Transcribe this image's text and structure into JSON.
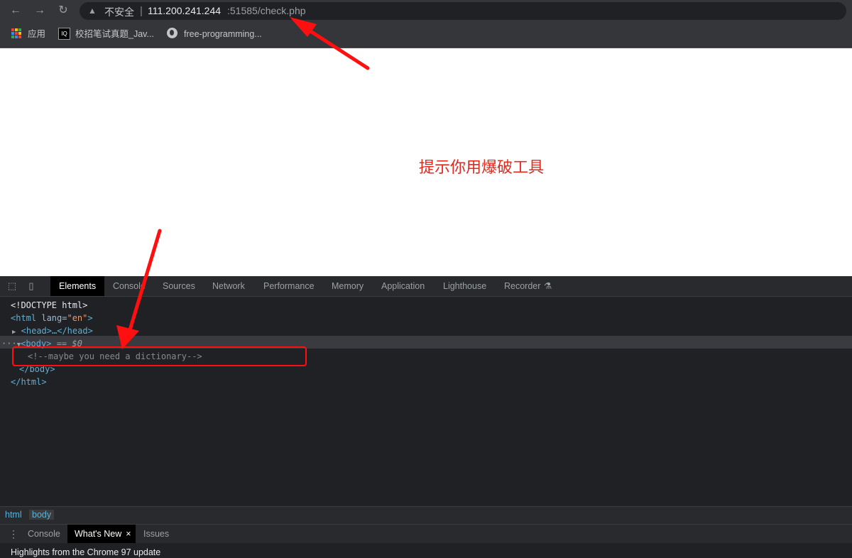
{
  "browser": {
    "back_icon": "arrow-left-icon",
    "forward_icon": "arrow-right-icon",
    "reload_icon": "reload-icon",
    "not_secure_label": "不安全",
    "url_host": "111.200.241.244",
    "url_rest": ":51585/check.php"
  },
  "bookmarks": [
    {
      "label": "应用",
      "icon": "apps-grid-icon"
    },
    {
      "label": "校招笔试真题_Jav...",
      "icon": "site-favicon-icon"
    },
    {
      "label": "free-programming...",
      "icon": "globe-icon"
    }
  ],
  "page": {
    "hint_text": "提示你用爆破工具"
  },
  "devtools": {
    "tabs": [
      "Elements",
      "Console",
      "Sources",
      "Network",
      "Performance",
      "Memory",
      "Application",
      "Lighthouse",
      "Recorder"
    ],
    "active_tab": "Elements",
    "tree": {
      "doctype": "<!DOCTYPE html>",
      "html_open_tag": "<html",
      "html_attr": "lang=",
      "html_attr_value": "\"en\"",
      "html_close_bracket": ">",
      "head": "<head>…</head>",
      "body_open": "<body>",
      "body_marker": "== $0",
      "comment": "<!--maybe you need a dictionary-->",
      "body_close": "</body>",
      "html_close": "</html>"
    },
    "breadcrumb": [
      "html",
      "body"
    ],
    "drawer_tabs": [
      "Console",
      "What's New",
      "Issues"
    ],
    "drawer_active": "What's New",
    "whats_new_text": "Highlights from the Chrome 97 update"
  },
  "colors": {
    "hint": "#e5281c",
    "annotation": "#ff0f0f"
  }
}
